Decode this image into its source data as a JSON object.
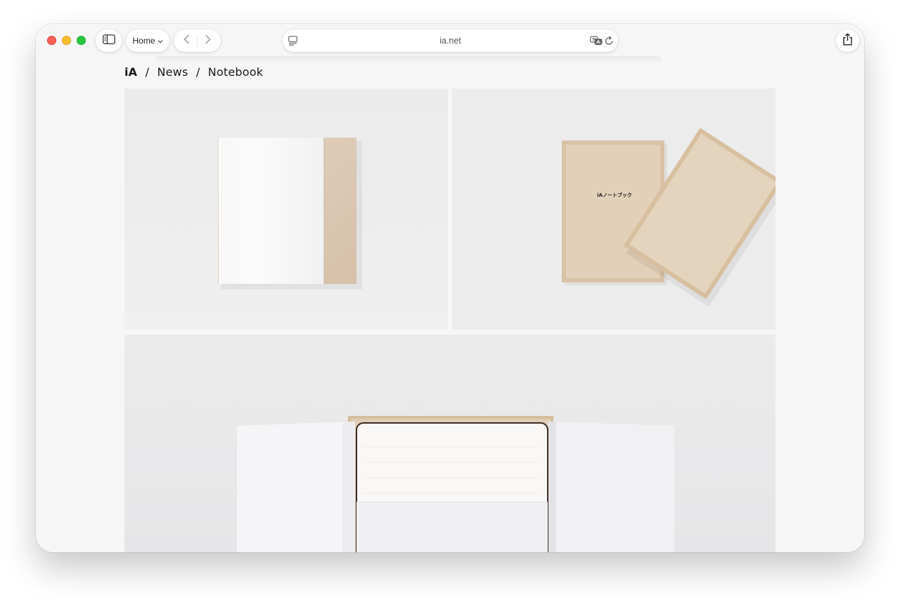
{
  "toolbar": {
    "home_label": "Home",
    "address_url": "ia.net"
  },
  "breadcrumb": {
    "brand": "iA",
    "sep1": "/",
    "section": "News",
    "sep2": "/",
    "page": "Notebook"
  },
  "photos": {
    "box_label": "iAノートブック"
  },
  "icons": {
    "sidebar": "sidebar-icon",
    "chevron": "chevron-down-icon",
    "back": "back-arrow-icon",
    "forward": "forward-arrow-icon",
    "reader": "reader-icon",
    "translate": "translate-icon",
    "reload": "reload-icon",
    "share": "share-icon"
  },
  "colors": {
    "close": "#fe5f57",
    "minimize": "#febc2e",
    "maximize": "#28c840",
    "wood": "#dcc6aa",
    "page_bg": "#f6f6f6"
  }
}
